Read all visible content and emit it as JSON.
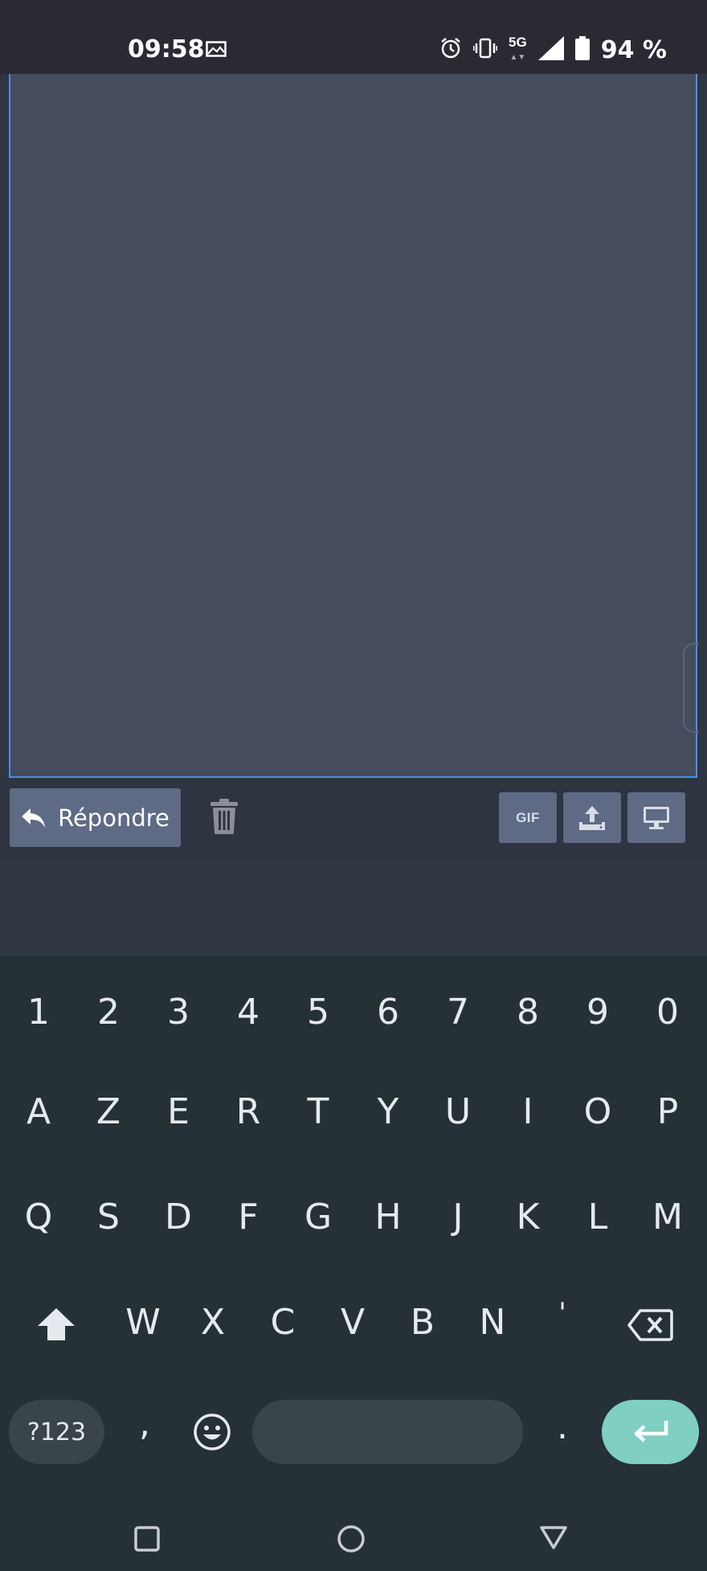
{
  "status_bar": {
    "time": "09:58",
    "network": "5G",
    "battery": "94 %",
    "icons": [
      "gallery-icon",
      "alarm-icon",
      "vibrate-icon",
      "signal-icon",
      "battery-icon"
    ]
  },
  "editor": {
    "value": ""
  },
  "toolbar": {
    "reply_label": "Répondre",
    "gif_label": "GIF"
  },
  "keyboard": {
    "numbers": [
      "1",
      "2",
      "3",
      "4",
      "5",
      "6",
      "7",
      "8",
      "9",
      "0"
    ],
    "row1": [
      "A",
      "Z",
      "E",
      "R",
      "T",
      "Y",
      "U",
      "I",
      "O",
      "P"
    ],
    "row2": [
      "Q",
      "S",
      "D",
      "F",
      "G",
      "H",
      "J",
      "K",
      "L",
      "M"
    ],
    "row3": [
      "W",
      "X",
      "C",
      "V",
      "B",
      "N",
      "'"
    ],
    "symbols_label": "?123",
    "comma": ",",
    "period": "."
  },
  "colors": {
    "accent_border": "#4a8fe0",
    "button": "#5f6a85",
    "enter": "#7fcfc2",
    "keyboard_bg": "#263037"
  }
}
